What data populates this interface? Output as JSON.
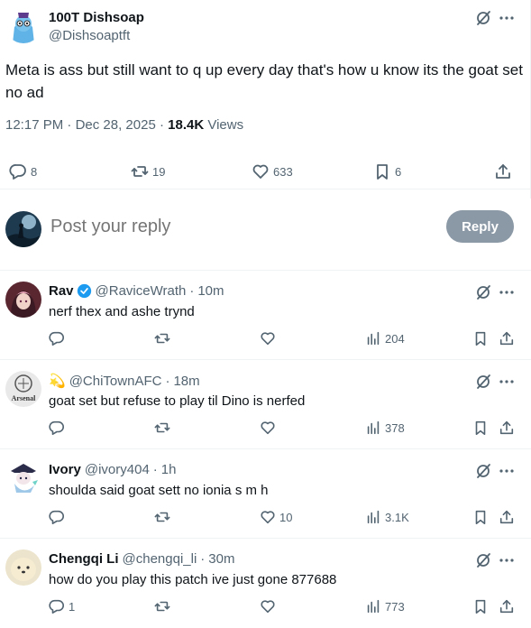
{
  "main_tweet": {
    "author_name": "100T Dishsoap",
    "author_handle": "@Dishsoaptft",
    "text": "Meta is ass but still want to q up every day that's how u know its the goat set no ad",
    "time": "12:17 PM",
    "date": "Dec 28, 2025",
    "views_count": "18.4K",
    "views_label": "Views",
    "replies": "8",
    "reposts": "19",
    "likes": "633",
    "bookmarks": "6"
  },
  "composer": {
    "placeholder": "Post your reply",
    "reply_label": "Reply"
  },
  "replies": [
    {
      "name": "Rav",
      "verified": true,
      "handle": "@RaviceWrath",
      "time": "10m",
      "text": "nerf thex and ashe trynd",
      "replies": "",
      "reposts": "",
      "likes": "",
      "views": "204"
    },
    {
      "name": "",
      "emoji": "💫",
      "handle": "@ChiTownAFC",
      "time": "18m",
      "text": "goat set but refuse to play til Dino is nerfed",
      "replies": "",
      "reposts": "",
      "likes": "",
      "views": "378",
      "avatar_text": "Arsenal"
    },
    {
      "name": "Ivory",
      "handle": "@ivory404",
      "time": "1h",
      "text": "shoulda said goat sett no ionia s m h",
      "replies": "",
      "reposts": "",
      "likes": "10",
      "views": "3.1K"
    },
    {
      "name": "Chengqi Li",
      "handle": "@chengqi_li",
      "time": "30m",
      "text": "how do you play this patch ive just gone 877688",
      "replies": "1",
      "reposts": "",
      "likes": "",
      "views": "773"
    }
  ],
  "separator": "·",
  "colors": {
    "text": "#0f1419",
    "muted": "#536471",
    "verified": "#1d9bf0",
    "reply_button": "#8b98a5",
    "border": "#eff3f4"
  }
}
